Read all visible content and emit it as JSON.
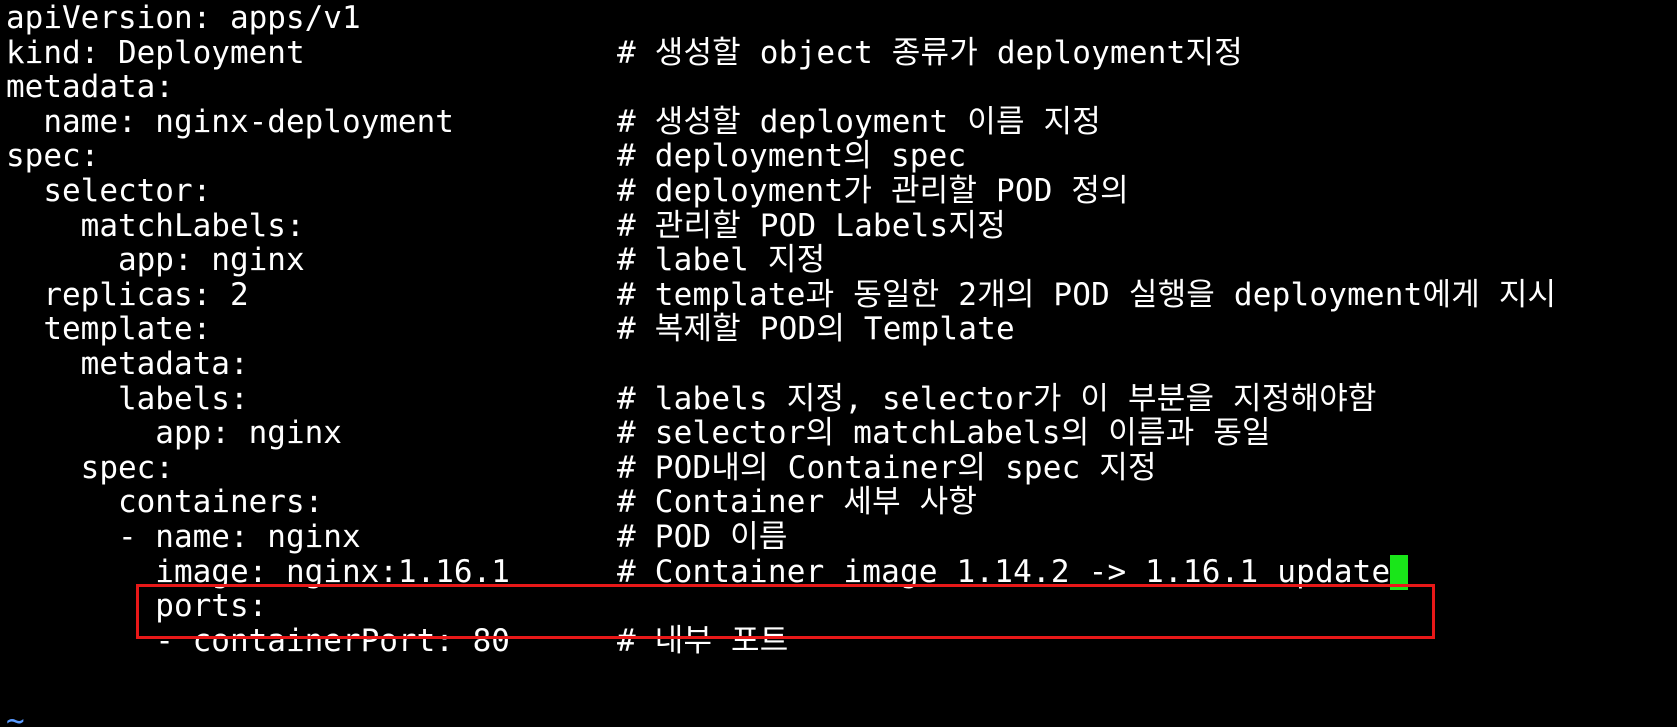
{
  "editor": {
    "lines": [
      {
        "code": "apiVersion: apps/v1",
        "comment": ""
      },
      {
        "code": "kind: Deployment",
        "comment": "# 생성할 object 종류가 deployment지정"
      },
      {
        "code": "metadata:",
        "comment": ""
      },
      {
        "code": "  name: nginx-deployment",
        "comment": "# 생성할 deployment 이름 지정"
      },
      {
        "code": "spec:",
        "comment": "# deployment의 spec"
      },
      {
        "code": "  selector:",
        "comment": "# deployment가 관리할 POD 정의"
      },
      {
        "code": "    matchLabels:",
        "comment": "# 관리할 POD Labels지정"
      },
      {
        "code": "      app: nginx",
        "comment": "# label 지정"
      },
      {
        "code": "  replicas: 2",
        "comment": "# template과 동일한 2개의 POD 실행을 deployment에게 지시"
      },
      {
        "code": "  template:",
        "comment": "# 복제할 POD의 Template"
      },
      {
        "code": "    metadata:",
        "comment": ""
      },
      {
        "code": "      labels:",
        "comment": "# labels 지정, selector가 이 부분을 지정해야함"
      },
      {
        "code": "        app: nginx",
        "comment": "# selector의 matchLabels의 이름과 동일"
      },
      {
        "code": "    spec:",
        "comment": "# POD내의 Container의 spec 지정"
      },
      {
        "code": "      containers:",
        "comment": "# Container 세부 사항"
      },
      {
        "code": "      - name: nginx",
        "comment": "# POD 이름"
      },
      {
        "code": "        image: nginx:1.16.1",
        "comment": "# Container image 1.14.2 -> 1.16.1 update"
      },
      {
        "code": "        ports:",
        "comment": ""
      },
      {
        "code": "        - containerPort: 80",
        "comment": "# 내부 포트"
      }
    ],
    "empty_line_marker": "~",
    "highlighted_line_index": 16,
    "cursor_line_index": 16,
    "colors": {
      "background": "#000000",
      "text": "#ffffff",
      "highlight_border": "#e81818",
      "cursor": "#19e619",
      "tilde": "#5a9bff"
    }
  }
}
